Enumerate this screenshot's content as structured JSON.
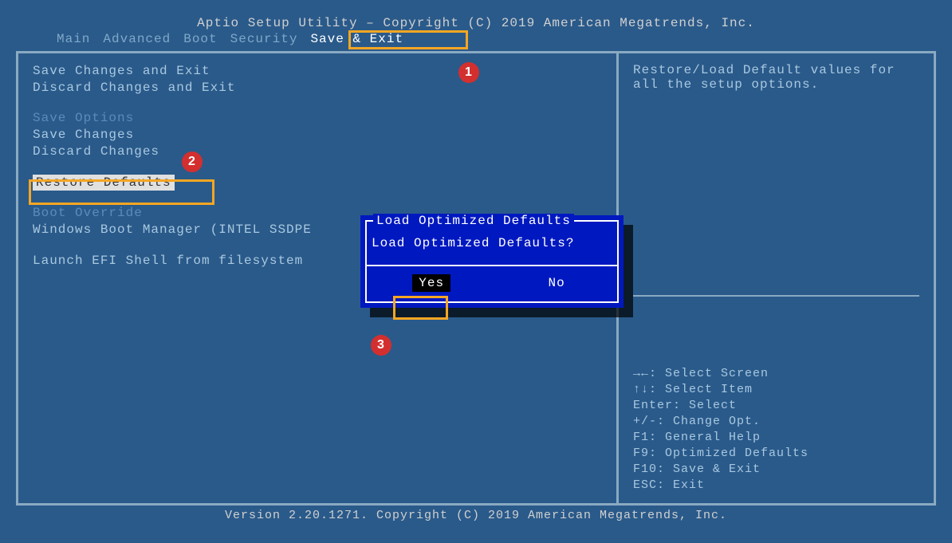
{
  "header": "Aptio Setup Utility – Copyright (C) 2019 American Megatrends, Inc.",
  "footer": "Version 2.20.1271. Copyright (C) 2019 American Megatrends, Inc.",
  "tabs": [
    "Main",
    "Advanced",
    "Boot",
    "Security",
    "Save & Exit"
  ],
  "active_tab_index": 4,
  "menu": {
    "items": [
      "Save Changes and Exit",
      "Discard Changes and Exit"
    ],
    "section1_header": "Save Options",
    "section1_items": [
      "Save Changes",
      "Discard Changes"
    ],
    "restore_defaults": "Restore Defaults",
    "section2_header": "Boot Override",
    "section2_items": [
      "Windows Boot Manager (INTEL SSDPE"
    ],
    "launch_efi": "Launch EFI Shell from filesystem"
  },
  "help": {
    "description": "Restore/Load Default values for all the setup options."
  },
  "key_hints": [
    "→←: Select Screen",
    "↑↓: Select Item",
    "Enter: Select",
    "+/-: Change Opt.",
    "F1: General Help",
    "F9: Optimized Defaults",
    "F10: Save & Exit",
    "ESC: Exit"
  ],
  "dialog": {
    "title": "Load Optimized Defaults",
    "message": "Load Optimized Defaults?",
    "yes": "Yes",
    "no": "No"
  },
  "annotations": {
    "a1": "1",
    "a2": "2",
    "a3": "3"
  }
}
